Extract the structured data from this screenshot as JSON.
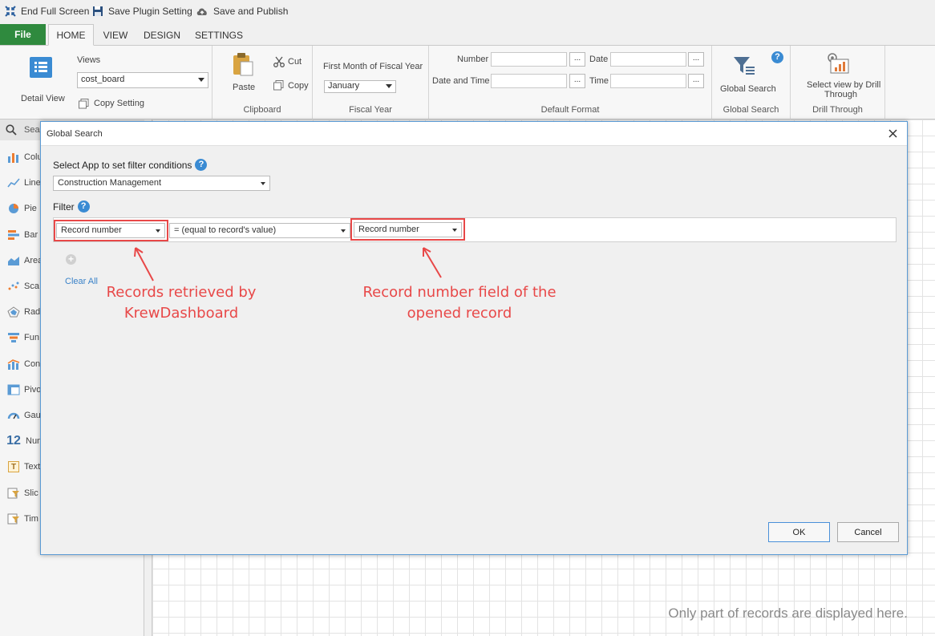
{
  "quick_access": {
    "end_full_screen": "End Full Screen",
    "save_plugin_setting": "Save Plugin Setting",
    "save_and_publish": "Save and Publish"
  },
  "tabs": {
    "file": "File",
    "home": "HOME",
    "view": "VIEW",
    "design": "DESIGN",
    "settings": "SETTINGS"
  },
  "ribbon": {
    "detail_view": "Detail View",
    "views_label": "Views",
    "views_value": "cost_board",
    "copy_setting": "Copy Setting",
    "paste": "Paste",
    "cut": "Cut",
    "copy": "Copy",
    "clipboard_group": "Clipboard",
    "fiscal_month_label": "First Month of Fiscal Year",
    "fiscal_month_value": "January",
    "fiscal_year_group": "Fiscal Year",
    "number_label": "Number",
    "date_label": "Date",
    "date_time_label": "Date and Time",
    "time_label": "Time",
    "ellipsis": "...",
    "default_format_group": "Default Format",
    "global_search": "Global Search",
    "global_search_group": "Global Search",
    "drill_label_line1": "Select view by Drill",
    "drill_label_line2": "Through",
    "drill_through_group": "Drill Through",
    "help": "?"
  },
  "sidebar": {
    "search_text": "Sea",
    "items": [
      {
        "label": "Colu",
        "icon": "column-chart-icon"
      },
      {
        "label": "Line",
        "icon": "line-chart-icon"
      },
      {
        "label": "Pie",
        "icon": "pie-chart-icon"
      },
      {
        "label": "Bar",
        "icon": "bar-chart-icon"
      },
      {
        "label": "Area",
        "icon": "area-chart-icon"
      },
      {
        "label": "Sca",
        "icon": "scatter-chart-icon"
      },
      {
        "label": "Rad",
        "icon": "radar-chart-icon"
      },
      {
        "label": "Fun",
        "icon": "funnel-chart-icon"
      },
      {
        "label": "Con",
        "icon": "combo-chart-icon"
      },
      {
        "label": "Pivo",
        "icon": "pivot-table-icon"
      },
      {
        "label": "Gau",
        "icon": "gauge-icon"
      },
      {
        "label": "Nun",
        "icon": "number-icon",
        "glyph": "12"
      },
      {
        "label": "Text",
        "icon": "text-icon",
        "glyph": "T"
      },
      {
        "label": "Slic",
        "icon": "slicer-icon"
      },
      {
        "label": "Tim",
        "icon": "timeline-icon"
      }
    ]
  },
  "canvas": {
    "note": "Only part of records are displayed here."
  },
  "dialog": {
    "title": "Global Search",
    "select_app_label": "Select App to set filter conditions",
    "app_value": "Construction Management",
    "filter_label": "Filter",
    "filter_field": "Record number",
    "filter_operator": "= (equal to record's value)",
    "filter_value_field": "Record number",
    "add": "+",
    "clear_all": "Clear All",
    "annotation_left_line1": "Records retrieved by",
    "annotation_left_line2": "KrewDashboard",
    "annotation_right_line1": "Record number field of the",
    "annotation_right_line2": "opened record",
    "ok": "OK",
    "cancel": "Cancel",
    "help": "?"
  },
  "colors": {
    "accent_green": "#2f8a3e",
    "annotation_red": "#e84848",
    "link_blue": "#3a82c8"
  }
}
